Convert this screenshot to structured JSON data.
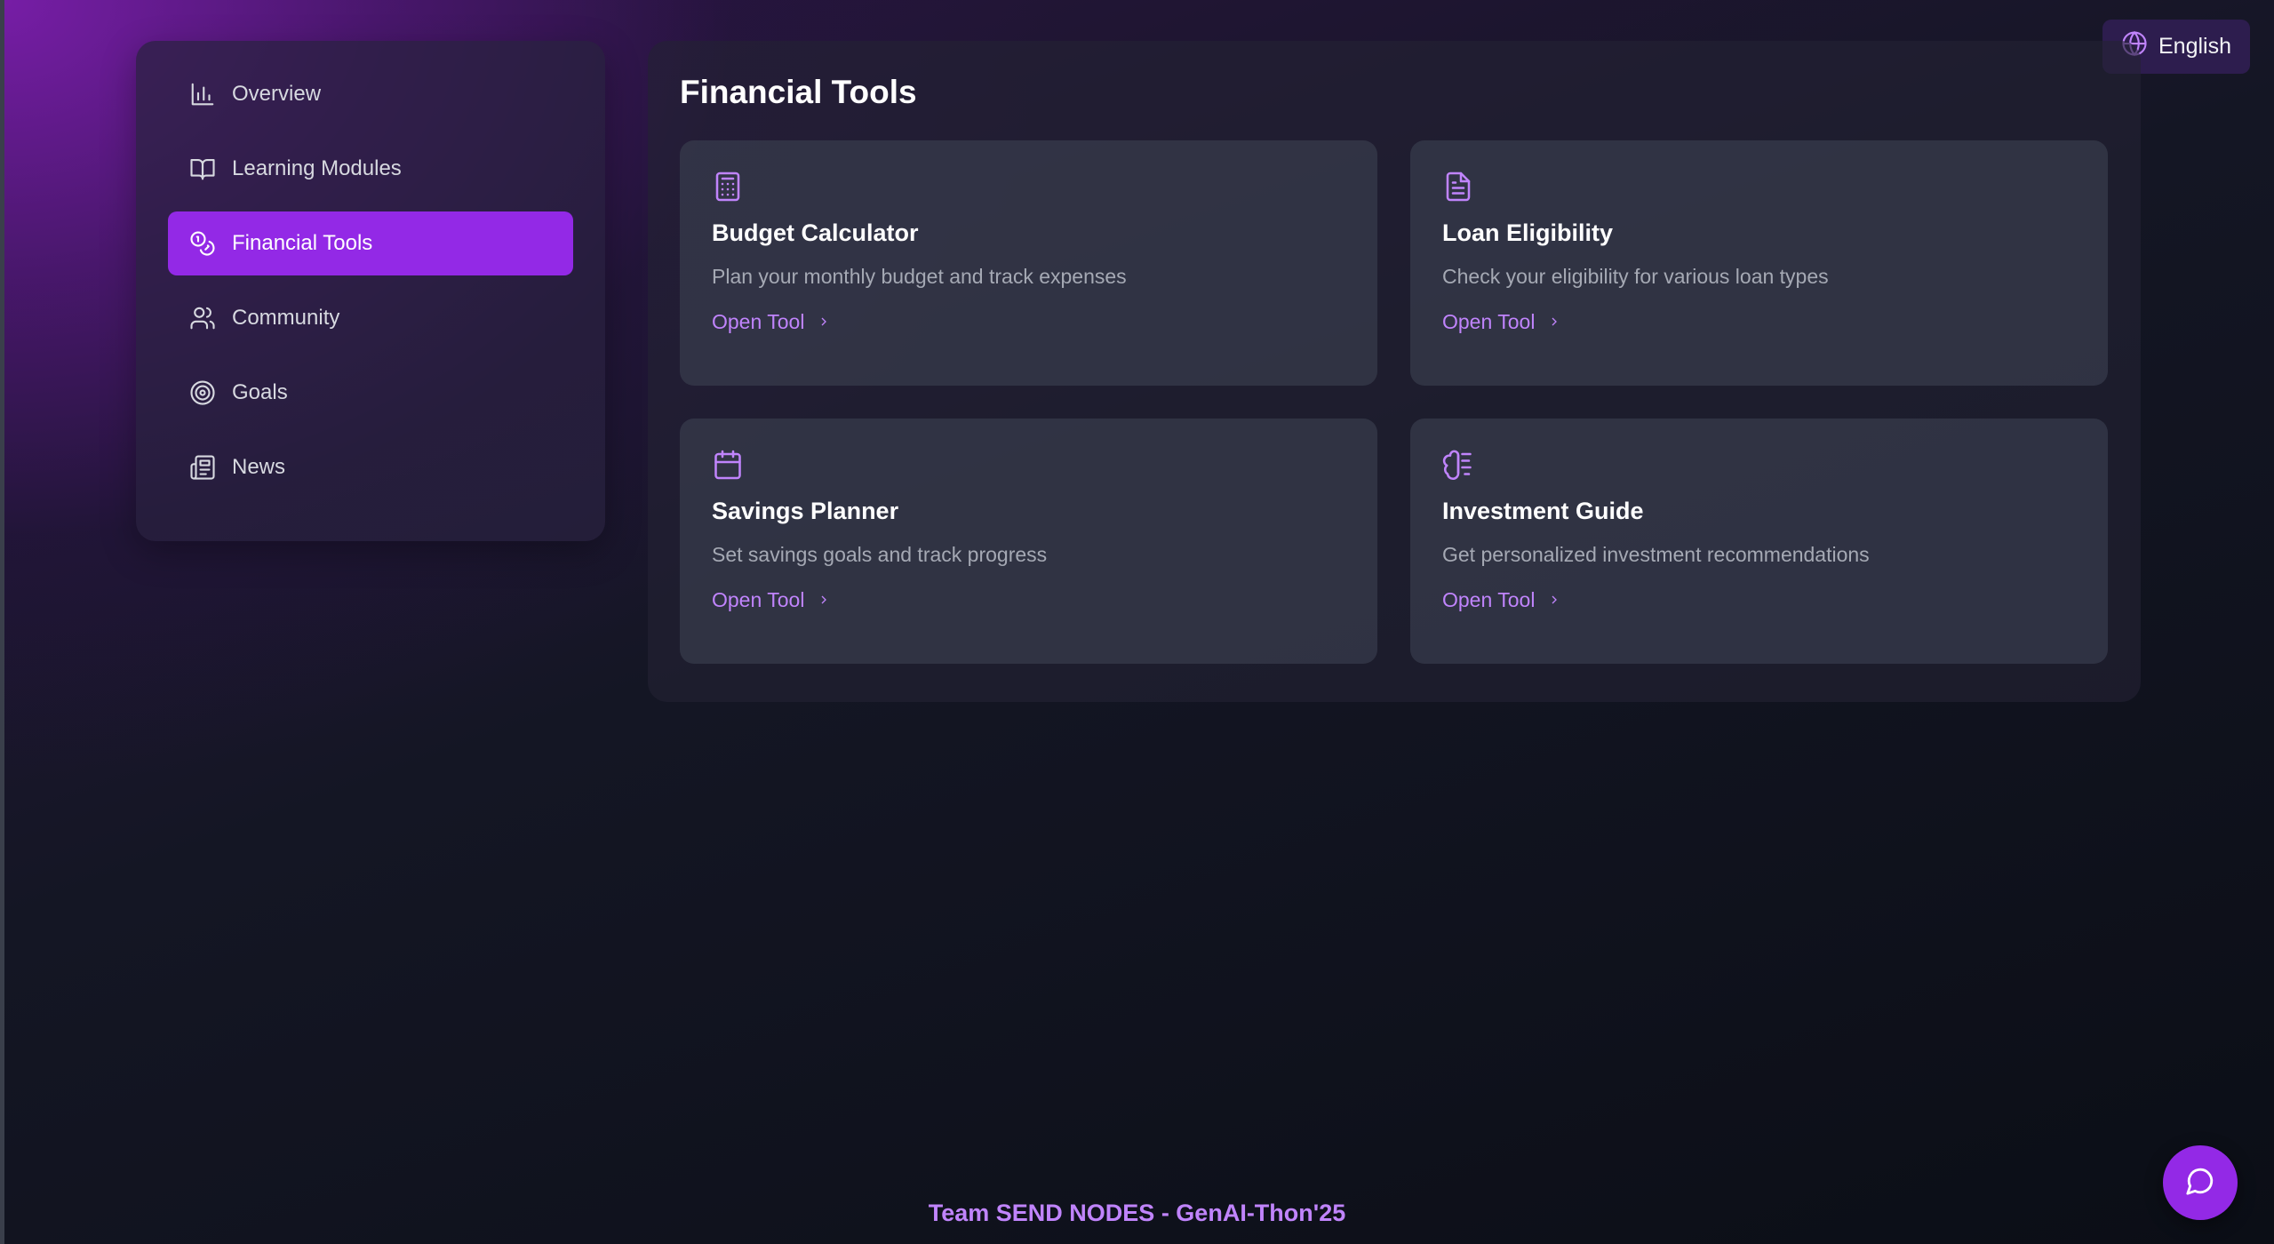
{
  "language": {
    "label": "English",
    "icon": "globe-icon"
  },
  "sidebar": {
    "items": [
      {
        "label": "Overview",
        "icon": "bar-chart-icon",
        "active": false
      },
      {
        "label": "Learning Modules",
        "icon": "book-open-icon",
        "active": false
      },
      {
        "label": "Financial Tools",
        "icon": "coins-icon",
        "active": true
      },
      {
        "label": "Community",
        "icon": "users-icon",
        "active": false
      },
      {
        "label": "Goals",
        "icon": "target-icon",
        "active": false
      },
      {
        "label": "News",
        "icon": "newspaper-icon",
        "active": false
      }
    ]
  },
  "main": {
    "title": "Financial Tools",
    "cards": [
      {
        "title": "Budget Calculator",
        "description": "Plan your monthly budget and track expenses",
        "link": "Open Tool",
        "icon": "calculator-icon"
      },
      {
        "title": "Loan Eligibility",
        "description": "Check your eligibility for various loan types",
        "link": "Open Tool",
        "icon": "file-text-icon"
      },
      {
        "title": "Savings Planner",
        "description": "Set savings goals and track progress",
        "link": "Open Tool",
        "icon": "calendar-icon"
      },
      {
        "title": "Investment Guide",
        "description": "Get personalized investment recommendations",
        "link": "Open Tool",
        "icon": "brain-icon"
      }
    ]
  },
  "footer": {
    "text": "Team SEND NODES - GenAI-Thon'25"
  },
  "chat": {
    "icon": "message-circle-icon"
  },
  "colors": {
    "accent": "#9329e6",
    "accent_text": "#c084fc",
    "card_background": "#373c4c",
    "sidebar_background": "#28213e"
  }
}
